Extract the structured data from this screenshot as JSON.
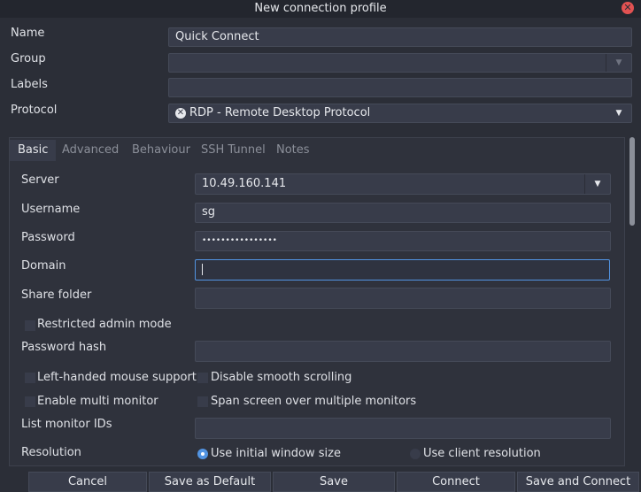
{
  "window": {
    "title": "New connection profile",
    "close_icon": "close-icon"
  },
  "profile": {
    "name_label": "Name",
    "name_value": "Quick Connect",
    "group_label": "Group",
    "group_value": "",
    "labels_label": "Labels",
    "labels_value": "",
    "protocol_label": "Protocol",
    "protocol_value": "RDP - Remote Desktop Protocol"
  },
  "tabs": [
    {
      "label": "Basic"
    },
    {
      "label": "Advanced"
    },
    {
      "label": "Behaviour"
    },
    {
      "label": "SSH Tunnel"
    },
    {
      "label": "Notes"
    }
  ],
  "basic": {
    "server_label": "Server",
    "server_value": "10.49.160.141",
    "username_label": "Username",
    "username_value": "sg",
    "password_label": "Password",
    "password_value": "••••••••••••••••",
    "domain_label": "Domain",
    "domain_value": "",
    "share_folder_label": "Share folder",
    "share_folder_value": "",
    "restricted_admin": "Restricted admin mode",
    "password_hash_label": "Password hash",
    "password_hash_value": "",
    "left_handed": "Left-handed mouse support",
    "disable_smooth": "Disable smooth scrolling",
    "multi_monitor": "Enable multi monitor",
    "span_screen": "Span screen over multiple monitors",
    "list_monitor_label": "List monitor IDs",
    "list_monitor_value": "",
    "resolution_label": "Resolution",
    "res_initial": "Use initial window size",
    "res_client": "Use client resolution"
  },
  "buttons": {
    "cancel": "Cancel",
    "save_default": "Save as Default",
    "save": "Save",
    "connect": "Connect",
    "save_connect": "Save and Connect"
  },
  "colors": {
    "accent": "#5294e2",
    "background": "#2b2e37",
    "field": "#383c4a",
    "close": "#e25252"
  }
}
